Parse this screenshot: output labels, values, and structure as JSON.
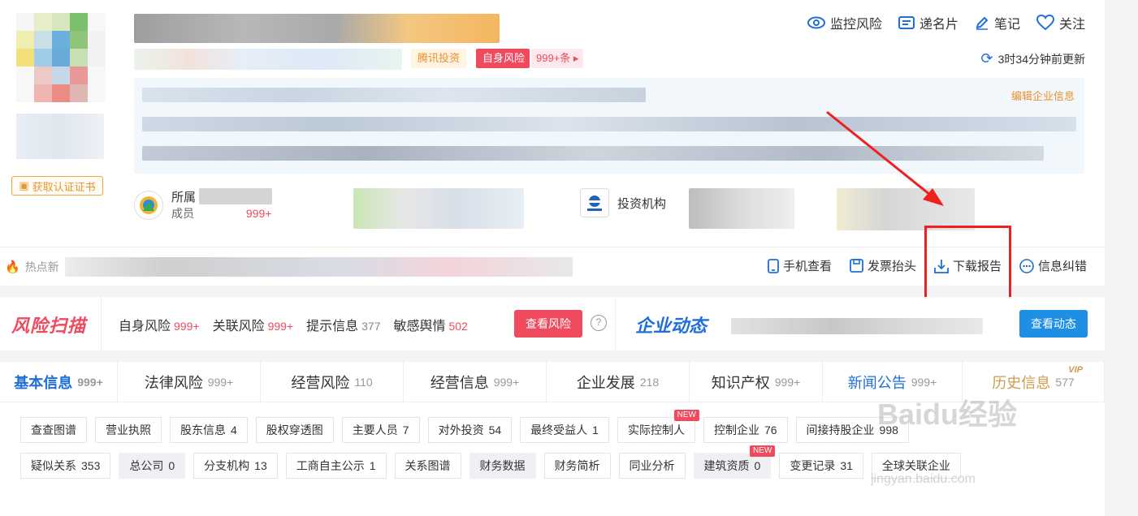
{
  "header": {
    "tags": {
      "tencent": "腾讯投资",
      "risk": "自身风险",
      "risk_count": "999+条"
    },
    "actions": {
      "monitor": "监控风险",
      "card": "递名片",
      "note": "笔记",
      "follow": "关注"
    },
    "update_text": "3时34分钟前更新",
    "edit_info": "编辑企业信息",
    "cert_btn": "获取认证证书",
    "group": {
      "label": "所属",
      "sub": "成员",
      "count": "999+"
    },
    "investor": {
      "label": "投资机构"
    }
  },
  "action_bar": {
    "hot_news": "热点新",
    "mobile": "手机查看",
    "invoice": "发票抬头",
    "download": "下载报告",
    "correct": "信息纠错"
  },
  "risk_scan": {
    "logo": "风险扫描",
    "items": [
      {
        "label": "自身风险",
        "count": "999+"
      },
      {
        "label": "关联风险",
        "count": "999+"
      },
      {
        "label": "提示信息",
        "count": "377"
      },
      {
        "label": "敏感舆情",
        "count": "502"
      }
    ],
    "btn": "查看风险",
    "help": "?",
    "dyn_logo": "企业动态",
    "dyn_btn": "查看动态"
  },
  "tabs": [
    {
      "label": "基本信息",
      "count": "999+"
    },
    {
      "label": "法律风险",
      "count": "999+"
    },
    {
      "label": "经营风险",
      "count": "110"
    },
    {
      "label": "经营信息",
      "count": "999+"
    },
    {
      "label": "企业发展",
      "count": "218"
    },
    {
      "label": "知识产权",
      "count": "999+"
    },
    {
      "label": "新闻公告",
      "count": "999+"
    },
    {
      "label": "历史信息",
      "count": "577"
    }
  ],
  "vip": "VIP",
  "subtabs_row1": [
    {
      "label": "查查图谱",
      "count": ""
    },
    {
      "label": "营业执照",
      "count": ""
    },
    {
      "label": "股东信息",
      "count": "4"
    },
    {
      "label": "股权穿透图",
      "count": ""
    },
    {
      "label": "主要人员",
      "count": "7"
    },
    {
      "label": "对外投资",
      "count": "54"
    },
    {
      "label": "最终受益人",
      "count": "1"
    },
    {
      "label": "实际控制人",
      "count": "",
      "badge": "NEW"
    },
    {
      "label": "控制企业",
      "count": "76"
    },
    {
      "label": "间接持股企业",
      "count": "998"
    }
  ],
  "subtabs_row2": [
    {
      "label": "疑似关系",
      "count": "353"
    },
    {
      "label": "总公司",
      "count": "0"
    },
    {
      "label": "分支机构",
      "count": "13"
    },
    {
      "label": "工商自主公示",
      "count": "1"
    },
    {
      "label": "关系图谱",
      "count": ""
    },
    {
      "label": "财务数据",
      "count": ""
    },
    {
      "label": "财务简析",
      "count": ""
    },
    {
      "label": "同业分析",
      "count": ""
    },
    {
      "label": "建筑资质",
      "count": "0",
      "badge": "NEW"
    },
    {
      "label": "变更记录",
      "count": "31"
    },
    {
      "label": "全球关联企业",
      "count": ""
    }
  ],
  "watermark": {
    "line1": "Baidu经验",
    "line2": "jingyan.baidu.com"
  }
}
